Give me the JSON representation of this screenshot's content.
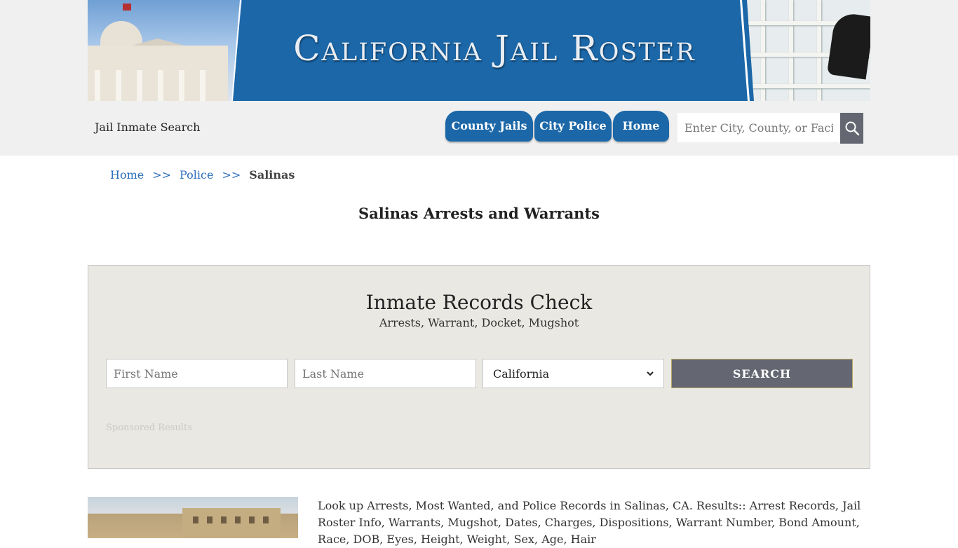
{
  "banner": {
    "title": "California Jail Roster"
  },
  "header": {
    "site_name": "Jail Inmate Search"
  },
  "nav": {
    "items": [
      "County Jails",
      "City Police",
      "Home"
    ]
  },
  "search": {
    "placeholder": "Enter City, County, or Facility"
  },
  "breadcrumb": {
    "home": "Home",
    "police": "Police",
    "current": "Salinas",
    "separator": ">>"
  },
  "page": {
    "title": "Salinas Arrests and Warrants"
  },
  "records_check": {
    "title": "Inmate Records Check",
    "subtitle": "Arrests, Warrant, Docket, Mugshot",
    "first_name_placeholder": "First Name",
    "last_name_placeholder": "Last Name",
    "state_selected": "California",
    "search_label": "SEARCH",
    "sponsored": "Sponsored Results"
  },
  "content": {
    "description": "Look up Arrests, Most Wanted, and Police Records in Salinas, CA. Results:: Arrest Records, Jail Roster Info, Warrants, Mugshot, Dates, Charges, Dispositions, Warrant Number, Bond Amount, Race, DOB, Eyes, Height, Weight, Sex, Age, Hair"
  },
  "colors": {
    "brand_blue": "#1b67a8",
    "button_gray": "#646771",
    "panel_bg": "#e9e8e3",
    "link": "#2a6ebb"
  }
}
